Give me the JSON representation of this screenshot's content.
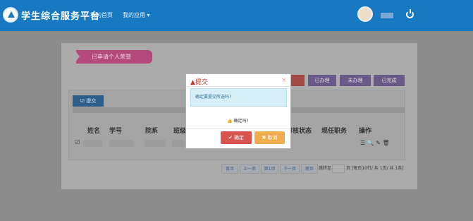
{
  "header": {
    "brand": "学生综合服务平台",
    "nav": [
      "我的首页",
      "我的应用 ▾"
    ]
  },
  "page": {
    "ribbon": "已申请个人荣誉",
    "filters": [
      "已提交",
      "已办理",
      "未办理",
      "已完成"
    ],
    "submit_tab": "☑ 提交",
    "columns": [
      "姓名",
      "学号",
      "院系",
      "班级",
      "审核状态",
      "现任职务",
      "操作"
    ],
    "row_icons": "☰ 🔍 ✎ 🗑",
    "pagination": {
      "buttons": [
        "首页",
        "上一页",
        "第1页",
        "下一页",
        "尾页"
      ],
      "goto": "跳转至",
      "summary": "页 [每页10行/ 共 1页/ 共 1条]"
    }
  },
  "modal": {
    "title": "提交",
    "close": "×",
    "message": "确定要提交所选吗?",
    "question": "确定吗?",
    "ok": "✔ 确定",
    "cancel": "✖ 取消"
  },
  "colors": {
    "topbar": "#1679c2",
    "ribbon": "#b34a7b",
    "danger": "#d9534f",
    "warning": "#f0ad4e"
  }
}
